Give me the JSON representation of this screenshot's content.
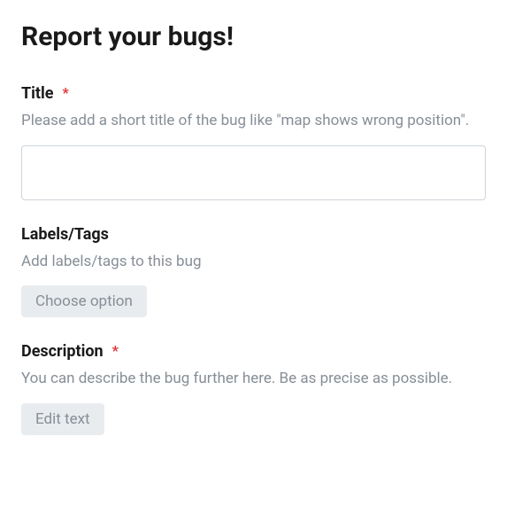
{
  "page": {
    "title": "Report your bugs!"
  },
  "fields": {
    "title": {
      "label": "Title",
      "required_marker": "*",
      "description": "Please add a short title of the bug like \"map shows wrong position\".",
      "value": ""
    },
    "labels": {
      "label": "Labels/Tags",
      "description": "Add labels/tags to this bug",
      "button_text": "Choose option"
    },
    "description": {
      "label": "Description",
      "required_marker": "*",
      "description": "You can describe the bug further here. Be as precise as possible.",
      "button_text": "Edit text"
    }
  }
}
